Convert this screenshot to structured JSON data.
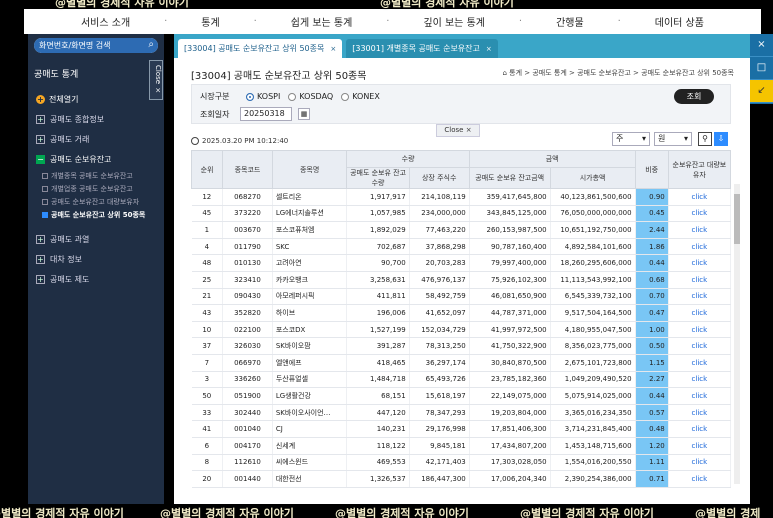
{
  "watermarks": [
    "@별별의 경제적 자유 이야기",
    "@별별의 경제적 자유 이야기",
    "@별별의 경제적 자유 이야기",
    "@별별의 경제적 자유 이야기",
    "@별별의 경제적 자유 이야기",
    "@별별의 경제적 자유 이야기",
    "@별별의 경제"
  ],
  "topnav": [
    "서비스 소개",
    "통계",
    "쉽게 보는 통계",
    "깊이 보는 통계",
    "간행물",
    "데이터 상품"
  ],
  "topnav_sep": "·",
  "sidebar": {
    "search_label": "화면번호/화면명 검색",
    "search_icon": "search-icon",
    "section": "공매도 통계",
    "section_toggle": "^",
    "open_all": "전체열기",
    "close_tab": "Close ×",
    "items": [
      {
        "label": "공매도 종합정보",
        "mark": "+"
      },
      {
        "label": "공매도 거래",
        "mark": "+"
      },
      {
        "label": "공매도 순보유잔고",
        "mark": "−"
      }
    ],
    "subitems": [
      "개별종목 공매도 순보유잔고",
      "개별업종 공매도 순보유잔고",
      "공매도 순보유잔고 대량보유자",
      "공매도 순보유잔고 상위 50종목"
    ],
    "items2": [
      {
        "label": "공매도 과열",
        "mark": "+"
      },
      {
        "label": "대차 정보",
        "mark": "+"
      },
      {
        "label": "공매도 제도",
        "mark": "+"
      }
    ]
  },
  "tabs": [
    {
      "label": "[33004] 공매도 순보유잔고 상위 50종목",
      "close": "×"
    },
    {
      "label": "[33001] 개별종목 공매도 순보유잔고",
      "close": "×"
    }
  ],
  "page_title": "[33004] 공매도 순보유잔고 상위 50종목",
  "breadcrumb": "통계 > 공매도 통계 > 공매도 순보유잔고 > 공매도 순보유잔고 상위 50종목",
  "filter": {
    "market_label": "시장구분",
    "markets": [
      "KOSPI",
      "KOSDAQ",
      "KONEX"
    ],
    "selected_market": "KOSPI",
    "date_label": "조회일자",
    "date_value": "20250318",
    "query_button": "조회"
  },
  "close_button": "Close ×",
  "timestamp": "2025.03.20 PM 10:12:40",
  "unit_select1": "주",
  "unit_select2": "원",
  "table": {
    "headers_top": [
      "순위",
      "종목코드",
      "종목명",
      "수량",
      "금액",
      "비중",
      "순보유잔고 대량보유자"
    ],
    "headers_sub": [
      "공매도 순보유 잔고수량",
      "상장 주식수",
      "공매도 순보유 잔고금액",
      "시가총액"
    ],
    "rows": [
      [
        "12",
        "068270",
        "셀트리온",
        "1,917,917",
        "214,108,119",
        "359,417,645,800",
        "40,123,861,500,600",
        "0.90",
        "click"
      ],
      [
        "45",
        "373220",
        "LG에너지솔루션",
        "1,057,985",
        "234,000,000",
        "343,845,125,000",
        "76,050,000,000,000",
        "0.45",
        "click"
      ],
      [
        "1",
        "003670",
        "포스코퓨처엠",
        "1,892,029",
        "77,463,220",
        "260,153,987,500",
        "10,651,192,750,000",
        "2.44",
        "click"
      ],
      [
        "4",
        "011790",
        "SKC",
        "702,687",
        "37,868,298",
        "90,787,160,400",
        "4,892,584,101,600",
        "1.86",
        "click"
      ],
      [
        "48",
        "010130",
        "고려아연",
        "90,700",
        "20,703,283",
        "79,997,400,000",
        "18,260,295,606,000",
        "0.44",
        "click"
      ],
      [
        "25",
        "323410",
        "카카오뱅크",
        "3,258,631",
        "476,976,137",
        "75,926,102,300",
        "11,113,543,992,100",
        "0.68",
        "click"
      ],
      [
        "21",
        "090430",
        "아모레퍼시픽",
        "411,811",
        "58,492,759",
        "46,081,650,900",
        "6,545,339,732,100",
        "0.70",
        "click"
      ],
      [
        "43",
        "352820",
        "하이브",
        "196,006",
        "41,652,097",
        "44,787,371,000",
        "9,517,504,164,500",
        "0.47",
        "click"
      ],
      [
        "10",
        "022100",
        "포스코DX",
        "1,527,199",
        "152,034,729",
        "41,997,972,500",
        "4,180,955,047,500",
        "1.00",
        "click"
      ],
      [
        "37",
        "326030",
        "SK바이오팜",
        "391,287",
        "78,313,250",
        "41,750,322,900",
        "8,356,023,775,000",
        "0.50",
        "click"
      ],
      [
        "7",
        "066970",
        "엘앤에프",
        "418,465",
        "36,297,174",
        "30,840,870,500",
        "2,675,101,723,800",
        "1.15",
        "click"
      ],
      [
        "3",
        "336260",
        "두산퓨얼셀",
        "1,484,718",
        "65,493,726",
        "23,785,182,360",
        "1,049,209,490,520",
        "2.27",
        "click"
      ],
      [
        "50",
        "051900",
        "LG생활건강",
        "68,151",
        "15,618,197",
        "22,149,075,000",
        "5,075,914,025,000",
        "0.44",
        "click"
      ],
      [
        "33",
        "302440",
        "SK바이오사이언…",
        "447,120",
        "78,347,293",
        "19,203,804,000",
        "3,365,016,234,350",
        "0.57",
        "click"
      ],
      [
        "41",
        "001040",
        "CJ",
        "140,231",
        "29,176,998",
        "17,851,406,300",
        "3,714,231,845,400",
        "0.48",
        "click"
      ],
      [
        "6",
        "004170",
        "신세계",
        "118,122",
        "9,845,181",
        "17,434,807,200",
        "1,453,148,715,600",
        "1.20",
        "click"
      ],
      [
        "8",
        "112610",
        "씨에스윈드",
        "469,553",
        "42,171,403",
        "17,303,028,050",
        "1,554,016,200,550",
        "1.11",
        "click"
      ],
      [
        "20",
        "001440",
        "대한전선",
        "1,326,537",
        "186,447,300",
        "17,006,204,340",
        "2,390,254,386,000",
        "0.71",
        "click"
      ]
    ]
  },
  "right_bar": [
    "×",
    "□",
    "↙"
  ]
}
